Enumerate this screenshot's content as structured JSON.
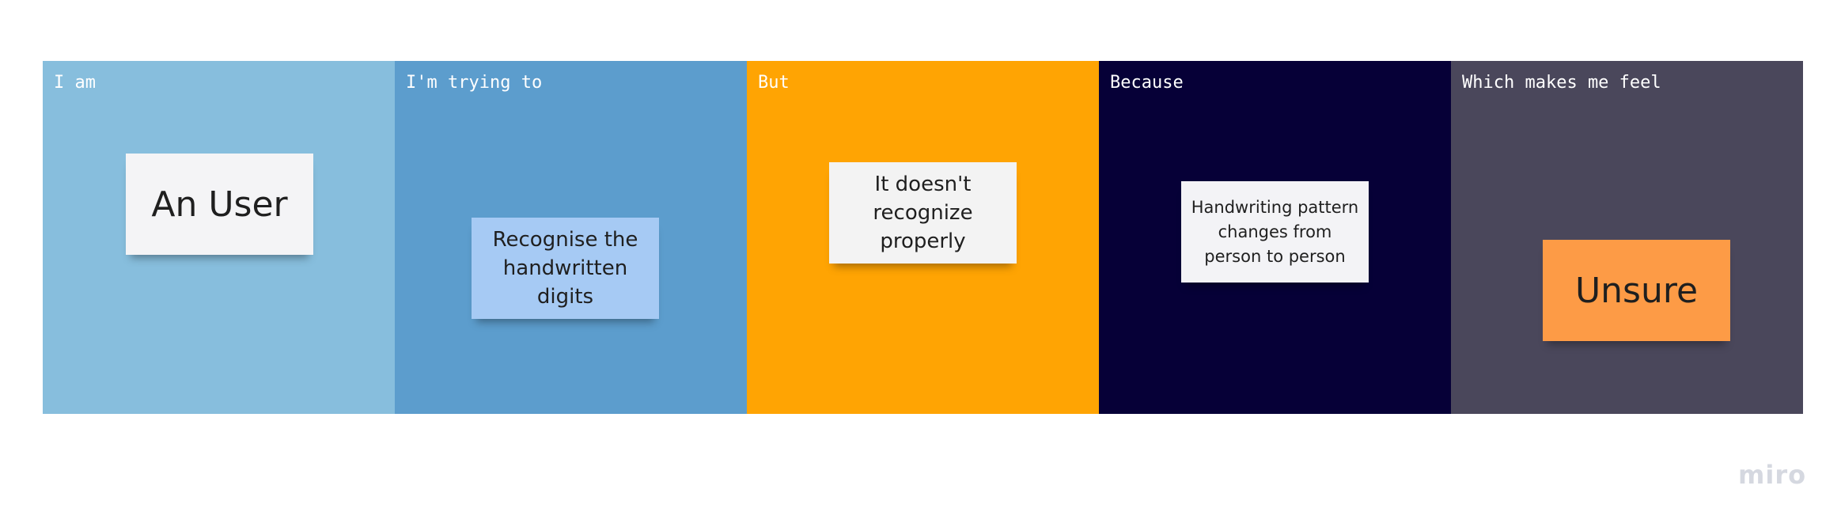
{
  "panels": [
    {
      "label": "I am",
      "color": "#87bedd",
      "note": {
        "text": "An User",
        "color": "#f4f4f6"
      }
    },
    {
      "label": "I'm trying to",
      "color": "#5c9dcd",
      "note": {
        "text": "Recognise the handwritten digits",
        "color": "#a6caf4"
      }
    },
    {
      "label": "But",
      "color": "#ffa403",
      "note": {
        "text": "It doesn't recognize properly",
        "color": "#f3f3f3"
      }
    },
    {
      "label": "Because",
      "color": "#060037",
      "note": {
        "text": "Handwriting pattern changes from person to person",
        "color": "#f3f3f6"
      }
    },
    {
      "label": "Which makes me feel",
      "color": "#4a475b",
      "note": {
        "text": "Unsure",
        "color": "#fd9b46"
      }
    }
  ],
  "branding": {
    "logo_text": "miro"
  }
}
